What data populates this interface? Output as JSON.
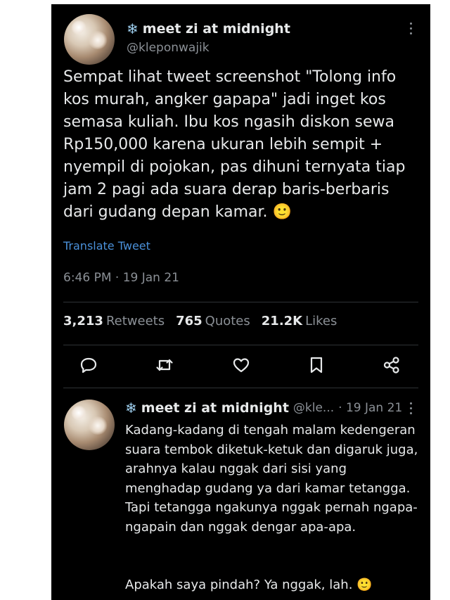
{
  "main_tweet": {
    "author_icon": "snowflake-icon",
    "author_name": "meet zi at midnight",
    "handle": "@kleponwajik",
    "text": "Sempat lihat tweet screenshot \"Tolong info kos murah, angker gapapa\" jadi inget kos semasa kuliah. Ibu kos ngasih diskon sewa Rp150,000 karena ukuran lebih sempit + nyempil di pojokan, pas dihuni ternyata tiap jam 2 pagi ada suara derap baris-berbaris dari gudang depan kamar.",
    "emoji": "🙂",
    "translate_label": "Translate Tweet",
    "timestamp": "6:46 PM · 19 Jan 21",
    "stats": {
      "retweets_count": "3,213",
      "retweets_label": "Retweets",
      "quotes_count": "765",
      "quotes_label": "Quotes",
      "likes_count": "21.2K",
      "likes_label": "Likes"
    },
    "actions": [
      "reply-icon",
      "retweet-icon",
      "like-icon",
      "bookmark-icon",
      "share-icon"
    ]
  },
  "reply_tweet": {
    "author_icon": "snowflake-icon",
    "author_name": "meet zi at midnight",
    "handle_truncated": "@kle...",
    "date": "· 19 Jan 21",
    "text": "Kadang-kadang di tengah malam kedengeran suara tembok diketuk-ketuk dan digaruk juga, arahnya kalau nggak dari sisi yang menghadap gudang ya dari kamar tetangga. Tapi tetangga ngakunya nggak pernah ngapa-ngapain dan nggak dengar apa-apa.",
    "text_2": "Apakah saya pindah? Ya nggak, lah.",
    "emoji": "🙂"
  },
  "colors": {
    "background": "#000000",
    "text": "#e7e9ea",
    "secondary": "#8b9096",
    "link": "#4a90d9",
    "divider": "#2f3336"
  }
}
